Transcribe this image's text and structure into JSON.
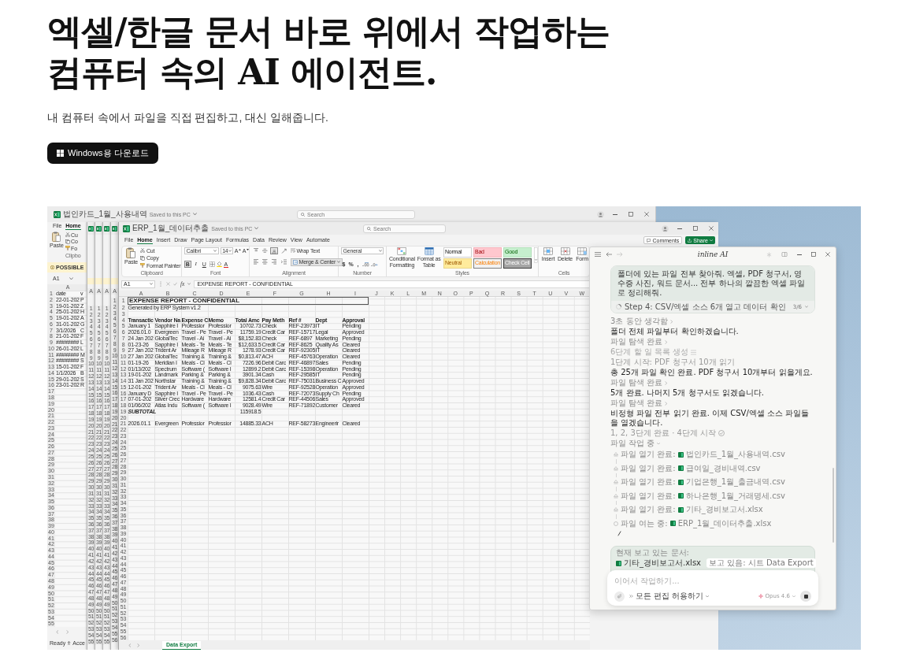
{
  "hero": {
    "title_lines": [
      "엑셀/한글 문서 바로 위에서 작업하는",
      "컴퓨터 속의 AI 에이전트."
    ],
    "subtitle": "내 컴퓨터 속에서 파일을 직접 편집하고, 대신 일해줍니다.",
    "download_button": "Windows용 다운로드"
  },
  "back_window": {
    "file_name": "법인카드_1월_사용내역",
    "save_status": "Saved to this PC",
    "search_placeholder": "Search",
    "menu": [
      {
        "label": "File",
        "selected": false
      },
      {
        "label": "Home",
        "selected": true
      }
    ],
    "paste_label": "Paste",
    "clipboard_items": [
      "Cu",
      "Co",
      "Fo"
    ],
    "group_label": "Clipbo",
    "message_label": "POSSIBLE",
    "name_box": "A1",
    "column_header": "A",
    "rows": [
      {
        "number": "1",
        "cells": [
          "date",
          "v"
        ]
      },
      {
        "number": "2",
        "cells": [
          "22-01-202",
          "P"
        ]
      },
      {
        "number": "3",
        "cells": [
          "19-01-202",
          "Z"
        ]
      },
      {
        "number": "4",
        "cells": [
          "25-01-202",
          "H"
        ]
      },
      {
        "number": "5",
        "cells": [
          "19-01-202",
          "A"
        ]
      },
      {
        "number": "6",
        "cells": [
          "31-01-202",
          "G"
        ]
      },
      {
        "number": "7",
        "cells": [
          "3/1/2026",
          "C"
        ]
      },
      {
        "number": "8",
        "cells": [
          "21-01-202",
          "F"
        ]
      },
      {
        "number": "9",
        "cells": [
          "########",
          "L"
        ]
      },
      {
        "number": "10",
        "cells": [
          "26-01-202",
          "L"
        ]
      },
      {
        "number": "11",
        "cells": [
          "########",
          "M"
        ]
      },
      {
        "number": "12",
        "cells": [
          "########",
          "S"
        ]
      },
      {
        "number": "13",
        "cells": [
          "15-01-202",
          "F"
        ]
      },
      {
        "number": "14",
        "cells": [
          "1/1/2026",
          "B"
        ]
      },
      {
        "number": "15",
        "cells": [
          "29-01-202",
          "S"
        ]
      },
      {
        "number": "16",
        "cells": [
          "23-01-202",
          "R"
        ]
      },
      {
        "number": "17"
      },
      {
        "number": "18"
      },
      {
        "number": "19"
      },
      {
        "number": "20"
      },
      {
        "number": "21"
      },
      {
        "number": "22"
      },
      {
        "number": "23"
      },
      {
        "number": "24"
      },
      {
        "number": "25"
      },
      {
        "number": "26"
      },
      {
        "number": "27"
      },
      {
        "number": "28"
      },
      {
        "number": "29"
      },
      {
        "number": "30"
      },
      {
        "number": "31"
      },
      {
        "number": "32"
      },
      {
        "number": "33"
      },
      {
        "number": "34"
      },
      {
        "number": "35"
      },
      {
        "number": "36"
      },
      {
        "number": "37"
      },
      {
        "number": "38"
      },
      {
        "number": "39"
      },
      {
        "number": "40"
      },
      {
        "number": "41"
      },
      {
        "number": "42"
      },
      {
        "number": "43"
      },
      {
        "number": "44"
      },
      {
        "number": "45"
      },
      {
        "number": "46"
      },
      {
        "number": "47"
      },
      {
        "number": "48"
      },
      {
        "number": "49"
      },
      {
        "number": "50"
      },
      {
        "number": "51"
      },
      {
        "number": "52"
      },
      {
        "number": "53"
      },
      {
        "number": "54"
      },
      {
        "number": "55"
      }
    ],
    "status": "Ready",
    "accessibility_label": "Acce"
  },
  "stacked_windows": [
    {
      "column_header": "A",
      "row_numbers": [
        "1",
        "2",
        "3",
        "4",
        "5",
        "6",
        "7",
        "8",
        "9",
        "10",
        "11",
        "12",
        "13",
        "14",
        "15",
        "16",
        "17",
        "18",
        "19",
        "20",
        "21",
        "22",
        "23",
        "24",
        "25",
        "26",
        "27",
        "28",
        "29",
        "30",
        "31",
        "32",
        "33",
        "34",
        "35",
        "36",
        "37",
        "38",
        "39",
        "40",
        "41",
        "42",
        "43",
        "44",
        "45",
        "46",
        "47",
        "48",
        "49",
        "50",
        "51",
        "52",
        "53",
        "54",
        "55"
      ]
    },
    {
      "column_header": "A",
      "row_numbers": [
        "1",
        "2",
        "3",
        "4",
        "5",
        "6",
        "7",
        "8",
        "9",
        "10",
        "11",
        "12",
        "13",
        "14",
        "15",
        "16",
        "17",
        "18",
        "19",
        "20",
        "21",
        "22",
        "23",
        "24",
        "25",
        "26",
        "27",
        "28",
        "29",
        "30",
        "31",
        "32",
        "33",
        "34",
        "35",
        "36",
        "37",
        "38",
        "39",
        "40",
        "41",
        "42",
        "43",
        "44",
        "45",
        "46",
        "47",
        "48",
        "49",
        "50",
        "51",
        "52",
        "53",
        "54",
        "55"
      ]
    },
    {
      "column_header": "A",
      "row_numbers": [
        "1",
        "2",
        "3",
        "4",
        "5",
        "6",
        "7",
        "8",
        "9",
        "10",
        "11",
        "12",
        "13",
        "14",
        "15",
        "16",
        "17",
        "18",
        "19",
        "20",
        "21",
        "22",
        "23",
        "24",
        "25",
        "26",
        "27",
        "28",
        "29",
        "30",
        "31",
        "32",
        "33",
        "34",
        "35",
        "36",
        "37",
        "38",
        "39",
        "40",
        "41",
        "42",
        "43",
        "44",
        "45",
        "46",
        "47",
        "48",
        "49",
        "50",
        "51",
        "52",
        "53",
        "54",
        "55"
      ]
    },
    {
      "column_header": "A",
      "row_numbers": [
        "1",
        "2",
        "3",
        "4",
        "5",
        "6",
        "7",
        "8",
        "9",
        "10",
        "11",
        "12",
        "13",
        "14",
        "15",
        "16",
        "17",
        "18",
        "19",
        "20",
        "21",
        "22",
        "23",
        "24",
        "25",
        "26",
        "27",
        "28",
        "29",
        "30",
        "31",
        "32",
        "33",
        "34",
        "35",
        "36",
        "37",
        "38",
        "39",
        "40",
        "41",
        "42",
        "43",
        "44",
        "45",
        "46",
        "47",
        "48",
        "49",
        "50",
        "51",
        "52",
        "53",
        "54",
        "55",
        "56"
      ]
    }
  ],
  "excel": {
    "file_name": "ERP_1월_데이터추출",
    "save_status": "Saved to this PC",
    "search_placeholder": "Search",
    "menu": [
      {
        "label": "File",
        "selected": false
      },
      {
        "label": "Home",
        "selected": true
      },
      {
        "label": "Insert",
        "selected": false
      },
      {
        "label": "Draw",
        "selected": false
      },
      {
        "label": "Page Layout",
        "selected": false
      },
      {
        "label": "Formulas",
        "selected": false
      },
      {
        "label": "Data",
        "selected": false
      },
      {
        "label": "Review",
        "selected": false
      },
      {
        "label": "View",
        "selected": false
      },
      {
        "label": "Automate",
        "selected": false
      }
    ],
    "comments_button": "Comments",
    "share_button": "Share",
    "ribbon": {
      "clipboard": {
        "paste": "Paste",
        "cut": "Cut",
        "copy": "Copy",
        "format_painter": "Format Painter",
        "label": "Clipboard"
      },
      "font": {
        "font_name": "Calibri",
        "font_size": "14",
        "size_buttons": [
          {
            "label": "A",
            "kind": "increase"
          },
          {
            "label": "A",
            "kind": "decrease"
          }
        ],
        "style_buttons": [
          {
            "label": "B",
            "kind": "bold",
            "selected": true
          },
          {
            "label": "I",
            "kind": "italic",
            "selected": false
          },
          {
            "label": "U",
            "kind": "underline",
            "selected": false
          }
        ],
        "font_color_button": "A",
        "label": "Font"
      },
      "alignment": {
        "vertical": [
          {
            "kind": "top",
            "selected": false
          },
          {
            "kind": "middle",
            "selected": false
          },
          {
            "kind": "bottom",
            "selected": true
          }
        ],
        "horizontal": [
          {
            "kind": "left",
            "selected": false
          },
          {
            "kind": "center",
            "selected": false
          },
          {
            "kind": "right",
            "selected": false
          }
        ],
        "wrap_text": "Wrap Text",
        "merge": {
          "label": "Merge & Center",
          "selected": true
        },
        "label": "Alignment"
      },
      "number": {
        "format": "General",
        "buttons": [
          "$",
          "%",
          ","
        ],
        "label": "Number"
      },
      "styles": {
        "conditional_formatting": [
          "Conditional",
          "Formatting"
        ],
        "format_as_table": [
          "Format as",
          "Table"
        ],
        "cell_styles": [
          {
            "label": "Normal",
            "kind": "normal"
          },
          {
            "label": "Bad",
            "kind": "bad"
          },
          {
            "label": "Good",
            "kind": "good"
          },
          {
            "label": "Neutral",
            "kind": "neutral"
          },
          {
            "label": "Calculation",
            "kind": "calculation"
          },
          {
            "label": "Check Cell",
            "kind": "check"
          }
        ],
        "label": "Styles"
      },
      "cells": {
        "buttons": [
          {
            "label": "Insert",
            "kind": "insert"
          },
          {
            "label": "Delete",
            "kind": "delete"
          },
          {
            "label": "Form",
            "kind": "format"
          }
        ],
        "label": "Cells"
      }
    },
    "name_box": "A1",
    "function_label": "fx",
    "formula": "EXPENSE REPORT - CONFIDENTIAL",
    "columns": [
      "A",
      "B",
      "C",
      "D",
      "E",
      "F",
      "G",
      "H",
      "I",
      "J",
      "K",
      "L",
      "M",
      "N",
      "O",
      "P",
      "Q",
      "R",
      "S",
      "T",
      "U",
      "V",
      "W"
    ],
    "rows": [
      {
        "number": "1",
        "kind": "title",
        "cells": [
          "EXPENSE REPORT - CONFIDENTIAL"
        ]
      },
      {
        "number": "2",
        "kind": "note",
        "cells": [
          "Generated by ERP System v1.2"
        ]
      },
      {
        "number": "3"
      },
      {
        "number": "4",
        "kind": "header",
        "cells": [
          "Transactic",
          "Vendor Na",
          "Expense C",
          "Memo",
          "Total Amc",
          "Pay Meth",
          "Ref #",
          "Dept",
          "Approval"
        ]
      },
      {
        "number": "5",
        "kind": "data",
        "cells": [
          "January 1",
          "Sapphire I",
          "Professior",
          "Professior",
          "10702.73",
          "Check",
          "REF-23973",
          "IT",
          "Pending"
        ]
      },
      {
        "number": "6",
        "kind": "data",
        "cells": [
          "2026.01.0",
          "Evergreen",
          "Travel - Pe",
          "Travel - Pe",
          "11759.19",
          "Credit Car",
          "REF-15717",
          "Legal",
          "Approved"
        ]
      },
      {
        "number": "7",
        "kind": "data",
        "cells": [
          "24 Jan 202",
          "GlobalTec",
          "Travel - Ai",
          "Travel - Ai",
          "$8,152.83",
          "Check",
          "REF-6897",
          "Marketing",
          "Pending"
        ]
      },
      {
        "number": "8",
        "kind": "data",
        "cells": [
          "01-23-26",
          "Sapphire I",
          "Meals - Te",
          "Meals - Te",
          "$12,633.5",
          "Credit Car",
          "REF-8625",
          "Quality As",
          "Cleared"
        ]
      },
      {
        "number": "9",
        "kind": "data",
        "cells": [
          "27 Jan 202",
          "Trident Ar",
          "Mileage R",
          "Mileage R",
          "1278.93",
          "Credit Car",
          "REF-92305",
          "IT",
          "Cleared"
        ]
      },
      {
        "number": "10",
        "kind": "data",
        "cells": [
          "27 Jan 202",
          "GlobalTec",
          "Training &",
          "Training &",
          "$0,813.47",
          "ACH",
          "REF-45763",
          "Operation",
          "Cleared"
        ]
      },
      {
        "number": "11",
        "kind": "data",
        "cells": [
          "01-19-26",
          "Meridian I",
          "Meals - Cl",
          "Meals - Cl",
          "7226.96",
          "Debit Carc",
          "REF-46897",
          "Sales",
          "Pending"
        ]
      },
      {
        "number": "12",
        "kind": "data",
        "cells": [
          "01/13/202",
          "Spectrum",
          "Software (",
          "Software I",
          "12899.2",
          "Debit Carc",
          "REF-15398",
          "Operation",
          "Pending"
        ]
      },
      {
        "number": "13",
        "kind": "data",
        "cells": [
          "19-01-202",
          "Landmark",
          "Parking &",
          "Parking &",
          "3901.34",
          "Cash",
          "REF-29585",
          "IT",
          "Pending"
        ]
      },
      {
        "number": "14",
        "kind": "data",
        "cells": [
          "31 Jan 202",
          "Northstar",
          "Training &",
          "Training &",
          "$9,828.34",
          "Debit Carc",
          "REF-75031",
          "Business C",
          "Approved"
        ]
      },
      {
        "number": "15",
        "kind": "data",
        "cells": [
          "12-01-202",
          "Trident Ar",
          "Meals - Cl",
          "Meals - Cl",
          "9075.63",
          "Wire",
          "REF-92528",
          "Operation",
          "Approved"
        ]
      },
      {
        "number": "16",
        "kind": "data",
        "cells": [
          "January D",
          "Sapphire I",
          "Travel - Pe",
          "Travel - Pe",
          "1036.43",
          "Cash",
          "REF-72073",
          "Supply Ch",
          "Pending"
        ]
      },
      {
        "number": "17",
        "kind": "data",
        "cells": [
          "07-01-202",
          "Silver Crec",
          "Hardware",
          "Hardware",
          "12581.4",
          "Credit Car",
          "REF-44506",
          "Sales",
          "Approved"
        ]
      },
      {
        "number": "18",
        "kind": "data",
        "cells": [
          "01/06/202",
          "Atlas Indu",
          "Software (",
          "Software I",
          "9028.49",
          "Wire",
          "REF-71892",
          "Customer",
          "Cleared"
        ]
      },
      {
        "number": "19",
        "kind": "subtotal",
        "label": "SUBTOTAL",
        "amount": "115918.5"
      },
      {
        "number": "20"
      },
      {
        "number": "21",
        "kind": "data",
        "cells": [
          "2026.01.1",
          "Evergreen",
          "Professior",
          "Professior",
          "14885.33",
          "ACH",
          "REF-58273",
          "Engineerir",
          "Cleared"
        ]
      },
      {
        "number": "22"
      },
      {
        "number": "23"
      },
      {
        "number": "24"
      },
      {
        "number": "25"
      },
      {
        "number": "26"
      },
      {
        "number": "27"
      },
      {
        "number": "28"
      },
      {
        "number": "29"
      },
      {
        "number": "30"
      },
      {
        "number": "31"
      },
      {
        "number": "32"
      },
      {
        "number": "33"
      },
      {
        "number": "34"
      },
      {
        "number": "35"
      },
      {
        "number": "36"
      },
      {
        "number": "37"
      },
      {
        "number": "38"
      },
      {
        "number": "39"
      },
      {
        "number": "40"
      },
      {
        "number": "41"
      },
      {
        "number": "42"
      },
      {
        "number": "43"
      },
      {
        "number": "44"
      },
      {
        "number": "45"
      },
      {
        "number": "46"
      },
      {
        "number": "47"
      },
      {
        "number": "48"
      },
      {
        "number": "49"
      },
      {
        "number": "50"
      },
      {
        "number": "51"
      },
      {
        "number": "52"
      },
      {
        "number": "53"
      },
      {
        "number": "54"
      },
      {
        "number": "55"
      },
      {
        "number": "56"
      }
    ],
    "sheet_tab": "Data Export"
  },
  "assistant": {
    "logo": "inline AI",
    "request": "폴더에 있는 파일 전부 찾아줘. 엑셀, PDF 청구서, 영수증 사진, 워드 문서... 전부 하나의 깔끔한 엑셀 파일로 정리해줘.",
    "step": {
      "label": "Step 4: CSV/엑셀 소스 6개 열고 데이터 확인",
      "count": "3/6"
    },
    "feed": [
      {
        "kind": "toggle",
        "text": "3초 동안 생각함"
      },
      {
        "kind": "message",
        "text": "폴더 전체 파일부터 확인하겠습니다."
      },
      {
        "kind": "toggle",
        "text": "파일 탐색 완료"
      },
      {
        "kind": "todo",
        "text": "6단계 할 일 목록 생성"
      },
      {
        "kind": "note",
        "text": "1단계 시작: PDF 청구서 10개 읽기"
      },
      {
        "kind": "message",
        "text": "총 25개 파일 확인 완료. PDF 청구서 10개부터 읽을게요."
      },
      {
        "kind": "toggle",
        "text": "파일 탐색 완료"
      },
      {
        "kind": "message",
        "text": "5개 완료. 나머지 5개 청구서도 읽겠습니다."
      },
      {
        "kind": "toggle",
        "text": "파일 탐색 완료"
      },
      {
        "kind": "message",
        "text": "비정형 파일 전부 읽기 완료. 이제 CSV/엑셀 소스 파일들을 열겠습니다."
      },
      {
        "kind": "done",
        "text": "1, 2, 3단계 완료 · 4단계 시작"
      },
      {
        "kind": "group",
        "text": "파일 작업 중"
      }
    ],
    "file_ops": [
      {
        "action": "파일 열기 완료:",
        "file": "법인카드_1월_사용내역.csv",
        "done": true
      },
      {
        "action": "파일 열기 완료:",
        "file": "급여일_경비내역.csv",
        "done": true
      },
      {
        "action": "파일 열기 완료:",
        "file": "기업은행_1월_출금내역.csv",
        "done": true
      },
      {
        "action": "파일 열기 완료:",
        "file": "하나은행_1월_거래명세.csv",
        "done": true
      },
      {
        "action": "파일 열기 완료:",
        "file": "기타_경비보고서.xlsx",
        "done": true
      },
      {
        "action": "파일 여는 중:",
        "file": "ERP_1월_데이터추출.xlsx",
        "done": false
      }
    ],
    "context": {
      "label": "현재 보고 있는 문서:",
      "file": "기타_경비보고서.xlsx",
      "sheet": "보고 있음: 시트 Data Export"
    },
    "composer": {
      "placeholder": "이어서 작업하기...",
      "permission": "모든 편집 허용하기",
      "model": "Opus 4.6"
    }
  }
}
